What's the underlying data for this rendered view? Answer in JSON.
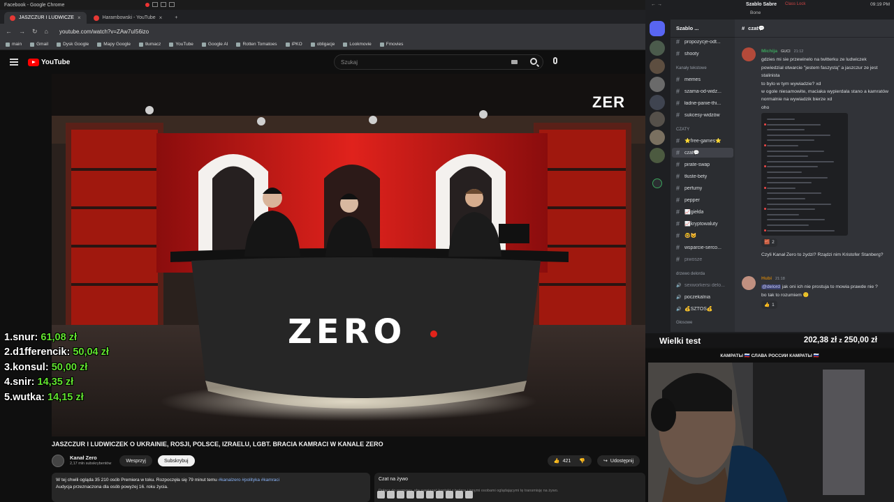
{
  "os": {
    "app_title": "Facebook - Google Chrome"
  },
  "tabs": [
    {
      "label": "JASZCZUR I LUDWICZE"
    },
    {
      "label": "Harambowski - YouTube"
    }
  ],
  "address": {
    "url": "youtube.com/watch?v=ZAw7uI56izo"
  },
  "bookmarks": [
    "main",
    "Gmail",
    "Dysk Google",
    "Mapy Google",
    "tłumacz",
    "YouTube",
    "Google AI",
    "Rotten Tomatoes",
    "iPKO",
    "obligacje",
    "Lookmovie",
    "Fmovies"
  ],
  "youtube": {
    "logo": "YouTube",
    "search_placeholder": "Szukaj",
    "video_title": "JASZCZUR I LUDWICZEK O UKRAINIE, ROSJI, POLSCE, IZRAELU, LGBT. BRACIA KAMRACI W KANALE ZERO",
    "channel_name": "Kanał Zero",
    "subscribers": "2,17 mln subskrybentów",
    "support_label": "Wesprzyj",
    "subscribe_label": "Subskrybuj",
    "likes": "421",
    "share_label": "Udostępnij",
    "desc_line1": "W tej chwili ogląda 35 210 osób  Premiera w toku. Rozpoczęła się 79 minut temu",
    "desc_tags": "#kanalzero #polityka #kamraci",
    "desc_line2": "Audycja przeznaczona dla osób powyżej 16. roku życia.",
    "livechat_title": "Czat na żywo",
    "livechat_sub": "Dołącz do rozmowy, aby nawiązać kontakt z twórcą i innymi osobami oglądającymi tę transmisję na żywo."
  },
  "overlay": {
    "studio_logo": "ZERO",
    "side_logo": "ZER",
    "donations": [
      {
        "rank": "1.",
        "name": "snur:",
        "amount": "61,08 zł"
      },
      {
        "rank": "2.",
        "name": "d1fferencik:",
        "amount": "50,04 zł"
      },
      {
        "rank": "3.",
        "name": "konsul:",
        "amount": "50,00 zł"
      },
      {
        "rank": "4.",
        "name": "snir:",
        "amount": "14,35 zł"
      },
      {
        "rank": "5.",
        "name": "wutka:",
        "amount": "14,15 zł"
      }
    ],
    "goal_label": "Wielki test",
    "goal_current": "202,38 zł",
    "goal_sep": "z",
    "goal_target": "250,00 zł",
    "banner": "КАМРАТЫ 🇷🇺 СЛАВА РОССИИ КАМРАТЫ 🇷🇺"
  },
  "discord": {
    "topbar_title": "Szablo Sabre",
    "topbar_sub": "Bone",
    "topbar_right": "Class Lock",
    "topbar_clock": "09:19 PM",
    "server_name": "Szablo ...",
    "current_channel": "czat💬",
    "channels_top": [
      "propozycje-odt...",
      "shooty"
    ],
    "cat_text": "Kanały tekstowe",
    "channels_text": [
      "memes",
      "szama-od-widz...",
      "ładne-panie-thi...",
      "sukcesy-widzów"
    ],
    "cat_chats": "CZATY",
    "channels_chats": [
      "⭐free-games⭐",
      "czat💬",
      "pirate-swap",
      "tłuste-bety",
      "perfumy",
      "pepper",
      "📈giełda",
      "📈kryptowaluty",
      "🤓😺",
      "wsparcie-serco...",
      "piwosze"
    ],
    "cat_voice": "drzewo delorda",
    "voice": [
      "sexworkersi delo...",
      "poczekalnia",
      "💰SZTOS💰"
    ],
    "cat_glosowe": "Głosowe",
    "messages": [
      {
        "user": "Michija",
        "tag": "GUCI",
        "time": "21:12",
        "lines": [
          "gdzies mi sie przewinelo na twitterku ze ludwiczek powiedzial otwarcie \"jestem faszystą\" a jaszczur ze jest stalinista",
          "to bylo w tym wywiadzie? xd",
          "w ogole niesamowite, maciaka wypierdala stano a kamratów normalnie na wywiadzik bierze xd",
          "oho"
        ],
        "reaction_count": "2"
      },
      {
        "user": "",
        "lines": [
          "Czyli Kanał Zero to żydzi? Rządzi nim Kristofer Stanberg?"
        ]
      },
      {
        "user": "Hubi",
        "time": "21:18",
        "mention": "@delord",
        "lines": [
          "jak oni ich nie prostuja to mowia prawde nie ?",
          "bo tak to rozumiem 🙂"
        ],
        "reaction_count": "1"
      }
    ],
    "colors": {
      "michija": "#3ba55c",
      "hubi": "#c27c0e",
      "mention_bg": "#3c4270"
    }
  }
}
